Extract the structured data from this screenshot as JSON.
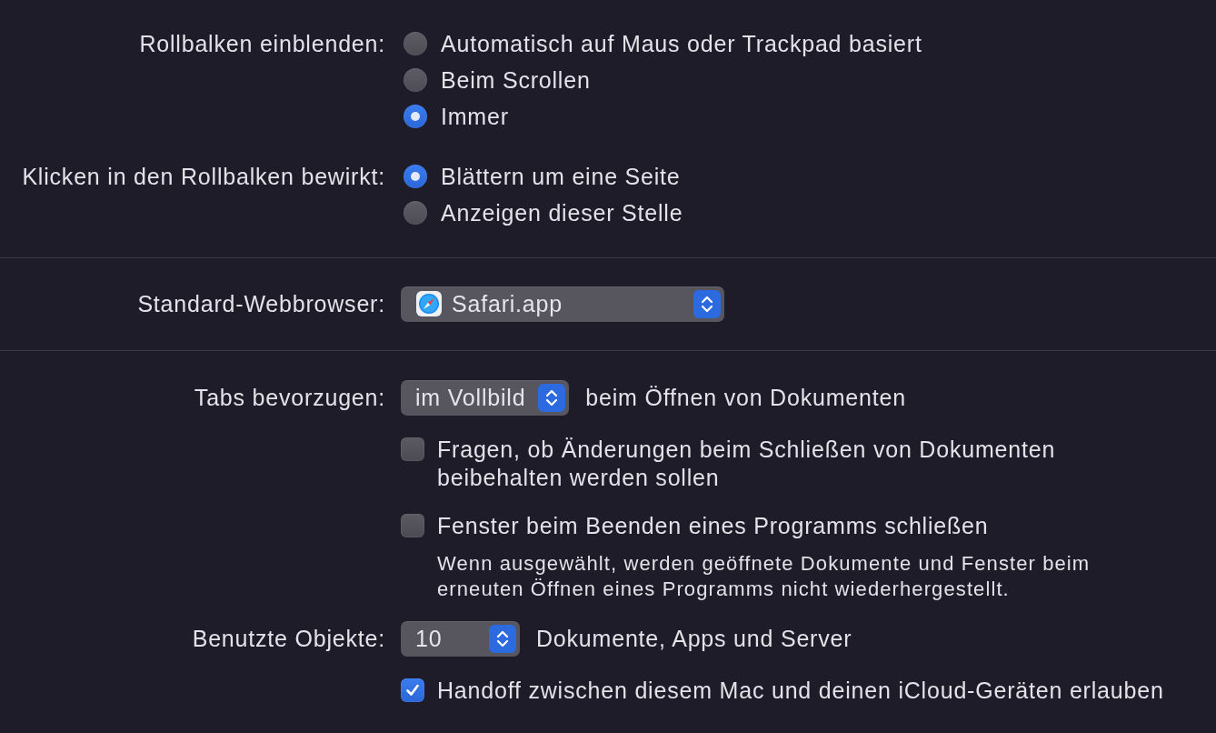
{
  "scrollbars": {
    "show": {
      "label": "Rollbalken einblenden:",
      "options": [
        {
          "label": "Automatisch auf Maus oder Trackpad basiert",
          "selected": false
        },
        {
          "label": "Beim Scrollen",
          "selected": false
        },
        {
          "label": "Immer",
          "selected": true
        }
      ]
    },
    "click": {
      "label": "Klicken in den Rollbalken bewirkt:",
      "options": [
        {
          "label": "Blättern um eine Seite",
          "selected": true
        },
        {
          "label": "Anzeigen dieser Stelle",
          "selected": false
        }
      ]
    }
  },
  "default_browser": {
    "label": "Standard-Webbrowser:",
    "value": "Safari.app"
  },
  "tabs": {
    "label": "Tabs bevorzugen:",
    "value": "im Vollbild",
    "suffix": "beim Öffnen von Dokumenten"
  },
  "checkboxes": [
    {
      "label": "Fragen, ob Änderungen beim Schließen von Dokumenten beibehalten werden sollen",
      "checked": false
    },
    {
      "label": "Fenster beim Beenden eines Programms schließen",
      "checked": false,
      "description": "Wenn ausgewählt, werden geöffnete Dokumente und Fenster beim erneuten Öffnen eines Programms nicht wiederhergestellt."
    }
  ],
  "recent_items": {
    "label": "Benutzte Objekte:",
    "value": "10",
    "suffix": "Dokumente, Apps und Server"
  },
  "handoff": {
    "label": "Handoff zwischen diesem Mac und deinen iCloud-Geräten erlauben",
    "checked": true
  }
}
